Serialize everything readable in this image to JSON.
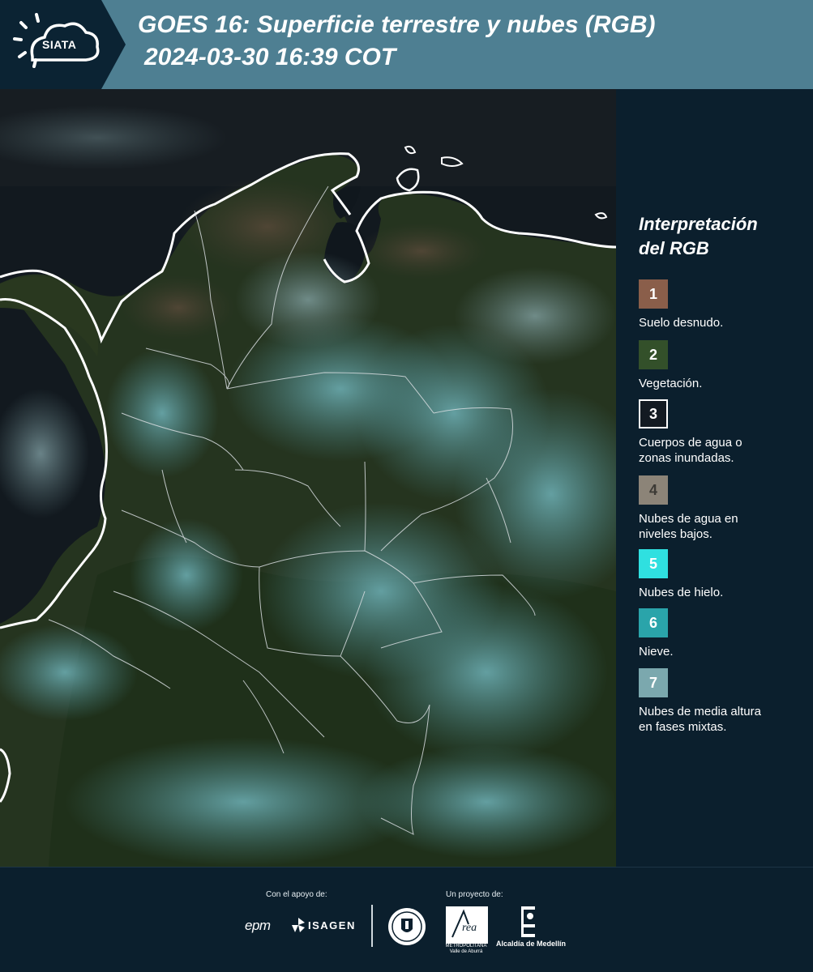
{
  "header": {
    "logo_text": "SIATA",
    "title_line1": "GOES 16: Superficie terrestre y nubes (RGB)",
    "title_line2": "2024-03-30 16:39 COT",
    "background_color": "#4e7f92"
  },
  "legend": {
    "title_line1": "Interpretación",
    "title_line2": "del RGB",
    "items": [
      {
        "number": "1",
        "label_line1": "Suelo desnudo.",
        "label_line2": "",
        "color": "#8a5e4a"
      },
      {
        "number": "2",
        "label_line1": "Vegetación.",
        "label_line2": "",
        "color": "#33502a"
      },
      {
        "number": "3",
        "label_line1": "Cuerpos de agua o",
        "label_line2": "zonas inundadas.",
        "color": "#131a22"
      },
      {
        "number": "4",
        "label_line1": "Nubes de agua en",
        "label_line2": "niveles bajos.",
        "color": "#8c8478"
      },
      {
        "number": "5",
        "label_line1": "Nubes de hielo.",
        "label_line2": "",
        "color": "#2fe0e0"
      },
      {
        "number": "6",
        "label_line1": "Nieve.",
        "label_line2": "",
        "color": "#2aa4aa"
      },
      {
        "number": "7",
        "label_line1": "Nubes de media altura",
        "label_line2": "en fases mixtas.",
        "color": "#7ba8ae"
      }
    ]
  },
  "footer": {
    "support_label": "Con el apoyo de:",
    "project_label": "Un proyecto de:",
    "sponsor_epm": "epm",
    "sponsor_isagen": "ISAGEN",
    "area_caption_line1": "METROPOLITANA",
    "area_caption_line2": "Valle de Aburrá",
    "alcaldia_label": "Alcaldía de Medellín"
  },
  "icons": [
    "sun-cloud-logo-icon",
    "isagen-mark-icon",
    "municipal-seal-icon",
    "area-metropolitana-logo-icon",
    "alcaldia-crest-icon"
  ]
}
